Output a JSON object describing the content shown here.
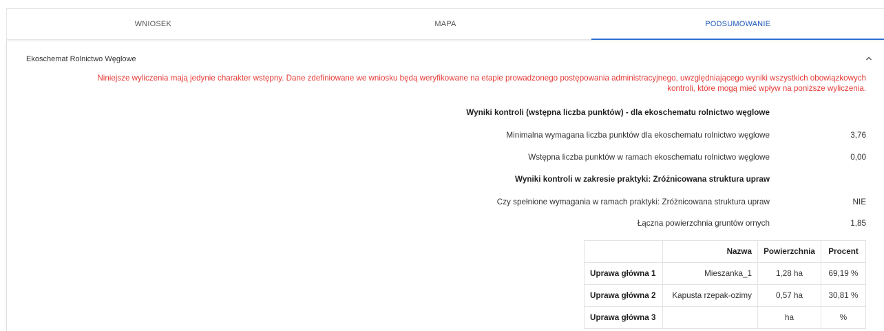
{
  "tabs": [
    {
      "label": "WNIOSEK",
      "active": false
    },
    {
      "label": "MAPA",
      "active": false
    },
    {
      "label": "PODSUMOWANIE",
      "active": true
    }
  ],
  "colors": {
    "accent": "#2d6fd1",
    "warning": "#e53935"
  },
  "section": {
    "title": "Ekoschemat Rolnictwo Węglowe",
    "toggle_icon": "chevron-up-icon",
    "notice": "Niniejsze wyliczenia mają jedynie charakter wstępny. Dane zdefiniowane we wniosku będą weryfikowane na etapie prowadzonego postępowania administracyjnego, uwzględniającego wyniki wszystkich obowiązkowych kontroli, które mogą mieć wpływ na poniższe wyliczenia.",
    "heading1": "Wyniki kontroli (wstępna liczba punktów) - dla ekoschematu rolnictwo węglowe",
    "min_points_label": "Minimalna wymagana liczba punktów dla ekoschematu rolnictwo węglowe",
    "min_points_value": "3,76",
    "init_points_label": "Wstępna liczba punktów w ramach ekoschematu rolnictwo węglowe",
    "init_points_value": "0,00",
    "heading2": "Wyniki kontroli w zakresie praktyki: Zróżnicowana struktura upraw",
    "req_label": "Czy spełnione wymagania w ramach praktyki: Zróżnicowana struktura upraw",
    "req_value": "NIE",
    "area_label": "Łączna powierzchnia gruntów ornych",
    "area_value": "1,85",
    "table": {
      "headers": [
        "",
        "Nazwa",
        "Powierzchnia",
        "Procent"
      ],
      "rows": [
        [
          "Uprawa główna 1",
          "Mieszanka_1",
          "1,28 ha",
          "69,19 %"
        ],
        [
          "Uprawa główna 2",
          "Kapusta rzepak-ozimy",
          "0,57 ha",
          "30,81 %"
        ],
        [
          "Uprawa główna 3",
          "",
          "ha",
          "%"
        ]
      ]
    }
  }
}
